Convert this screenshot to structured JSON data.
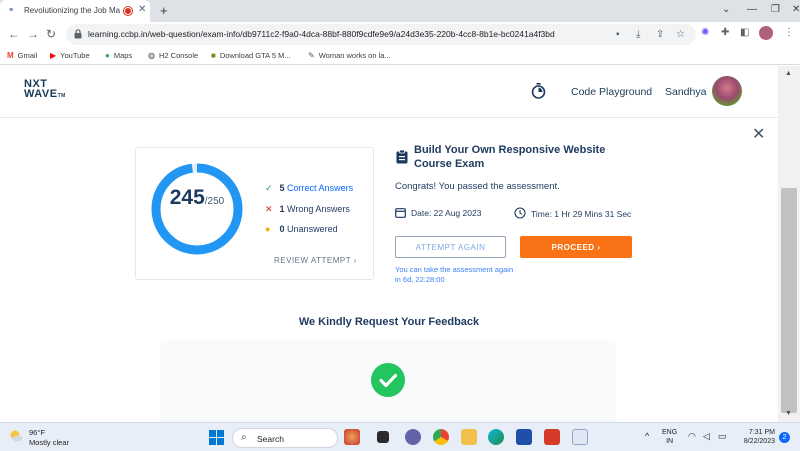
{
  "browser": {
    "tab_title": "Revolutionizing the Job Marke",
    "url": "learning.ccbp.in/web-question/exam-info/db9711c2-f9a0-4dca-88bf-880f9cdfe9e9/a24d3e35-220b-4cc8-8b1e-bc0241a4f3bd",
    "bookmarks": [
      {
        "label": "Gmail",
        "icon": "gmail-icon"
      },
      {
        "label": "YouTube",
        "icon": "youtube-icon"
      },
      {
        "label": "Maps",
        "icon": "maps-icon"
      },
      {
        "label": "H2 Console",
        "icon": "globe-icon"
      },
      {
        "label": "Download GTA 5 M...",
        "icon": "game-icon"
      },
      {
        "label": "Woman works on la...",
        "icon": "bookmark-icon"
      }
    ]
  },
  "header": {
    "logo_line1": "NXT",
    "logo_line2": "WAVE",
    "logo_tm": "TM",
    "code_playground": "Code Playground",
    "username": "Sandhya"
  },
  "result": {
    "score": "245",
    "total": "/250",
    "score_fraction": 0.98,
    "correct_count": "5",
    "correct_label": "Correct Answers",
    "wrong_count": "1",
    "wrong_label": "Wrong Answers",
    "unanswered_count": "0",
    "unanswered_label": "Unanswered",
    "review_label": "REVIEW ATTEMPT"
  },
  "exam": {
    "title": "Build Your Own Responsive Website Course Exam",
    "congrats": "Congrats! You passed the assessment.",
    "date": "Date: 22 Aug 2023",
    "time": "Time: 1 Hr 29 Mins 31 Sec",
    "attempt_again": "ATTEMPT AGAIN",
    "proceed": "PROCEED",
    "retake_note": "You can take the assessment again in 6d, 22:28:00"
  },
  "feedback": {
    "title": "We Kindly Request Your Feedback"
  },
  "taskbar": {
    "weather_temp": "96°F",
    "weather_desc": "Mostly clear",
    "search_label": "Search",
    "lang_line1": "ENG",
    "lang_line2": "IN",
    "time": "7:31 PM",
    "date": "8/22/2023",
    "notification_count": "2"
  },
  "colors": {
    "ring": "#2196f3",
    "proceed": "#f97316",
    "success": "#22c55e",
    "text_dark": "#1e3a5f"
  }
}
